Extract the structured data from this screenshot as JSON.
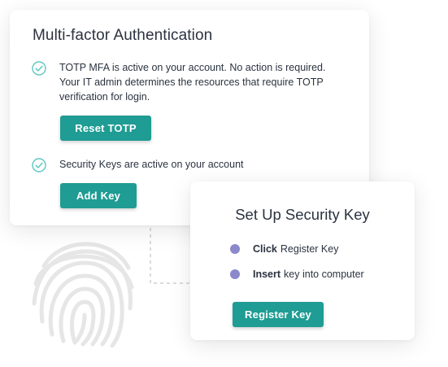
{
  "mfa_card": {
    "title": "Multi-factor Authentication",
    "totp": {
      "lines": [
        "TOTP MFA is active on your account. No action is required.",
        "Your IT admin determines the resources that require TOTP",
        "verification for login."
      ],
      "button_label": "Reset TOTP"
    },
    "security_keys": {
      "status": "Security Keys are active on your account",
      "button_label": "Add Key"
    }
  },
  "setup_card": {
    "title": "Set Up Security Key",
    "steps": [
      {
        "action": "Click",
        "text": "Register Key"
      },
      {
        "action": "Insert",
        "text": "key into computer"
      }
    ],
    "button_label": "Register Key"
  },
  "icons": {
    "status_check": "check-circle-icon",
    "decoration": "fingerprint-icon",
    "step_marker": "bullet-dot-icon"
  },
  "colors": {
    "accent": "#1f9c93",
    "check": "#5ec7c0",
    "step_dot": "#8b88cc",
    "text": "#2b3340",
    "fingerprint": "#e6e6e6",
    "connector": "#cfcfcf"
  }
}
